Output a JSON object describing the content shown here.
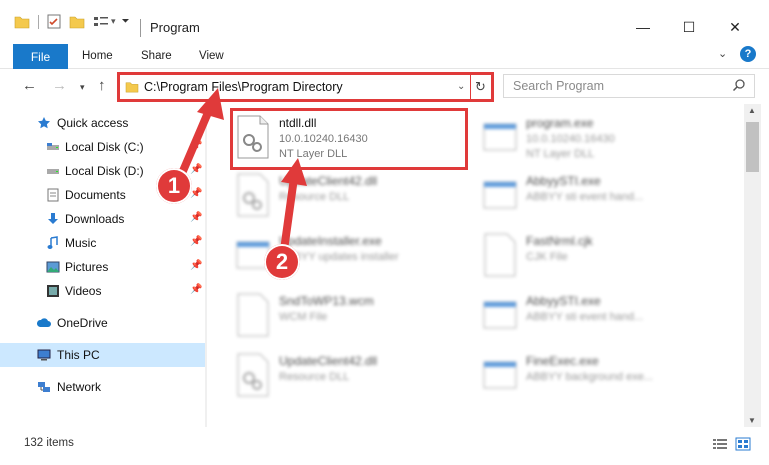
{
  "window": {
    "title": "Program",
    "minimize": "—",
    "maximize": "☐",
    "close": "✕"
  },
  "ribbon": {
    "tabs": [
      "File",
      "Home",
      "Share",
      "View"
    ],
    "help": "?"
  },
  "nav": {
    "address": "C:\\Program Files\\Program Directory",
    "search_placeholder": "Search Program"
  },
  "sidebar": {
    "items": [
      {
        "label": "Quick access",
        "icon": "star-icon"
      },
      {
        "label": "Local Disk (C:)",
        "icon": "drive-icon",
        "pinned": true
      },
      {
        "label": "Local Disk (D:)",
        "icon": "drive-icon",
        "pinned": true
      },
      {
        "label": "Documents",
        "icon": "documents-icon",
        "pinned": true
      },
      {
        "label": "Downloads",
        "icon": "downloads-icon",
        "pinned": true
      },
      {
        "label": "Music",
        "icon": "music-icon",
        "pinned": true
      },
      {
        "label": "Pictures",
        "icon": "pictures-icon",
        "pinned": true
      },
      {
        "label": "Videos",
        "icon": "videos-icon",
        "pinned": true
      },
      {
        "label": "OneDrive",
        "icon": "cloud-icon"
      },
      {
        "label": "This PC",
        "icon": "computer-icon",
        "selected": true
      },
      {
        "label": "Network",
        "icon": "network-icon"
      }
    ]
  },
  "files": [
    {
      "name": "ntdll.dll",
      "sub1": "10.0.10240.16430",
      "sub2": "NT Layer DLL",
      "highlighted": true,
      "type": "dll"
    },
    {
      "name": "program.exe",
      "sub1": "10.0.10240.16430",
      "sub2": "NT Layer DLL",
      "type": "exe"
    },
    {
      "name": "UpdateClient42.dll",
      "sub1": "Resource DLL",
      "sub2": "",
      "type": "dll"
    },
    {
      "name": "AbbyySTI.exe",
      "sub1": "ABBYY sti event hand...",
      "sub2": "",
      "type": "exe"
    },
    {
      "name": "UpdateInstaller.exe",
      "sub1": "ABBYY updates installer",
      "sub2": "",
      "type": "exe"
    },
    {
      "name": "FastNrml.cjk",
      "sub1": "CJK File",
      "sub2": "",
      "type": "file"
    },
    {
      "name": "SndToWP13.wcm",
      "sub1": "WCM File",
      "sub2": "",
      "type": "file"
    },
    {
      "name": "AbbyySTI.exe",
      "sub1": "ABBYY sti event hand...",
      "sub2": "",
      "type": "exe"
    },
    {
      "name": "UpdateClient42.dll",
      "sub1": "Resource DLL",
      "sub2": "",
      "type": "dll"
    },
    {
      "name": "FineExec.exe",
      "sub1": "ABBYY background exe...",
      "sub2": "",
      "type": "exe"
    }
  ],
  "status": {
    "count": "132 items"
  },
  "annotations": [
    "1",
    "2"
  ],
  "colors": {
    "accent": "#1979ca",
    "highlight": "#e03a3a",
    "selected": "#cce8ff"
  }
}
